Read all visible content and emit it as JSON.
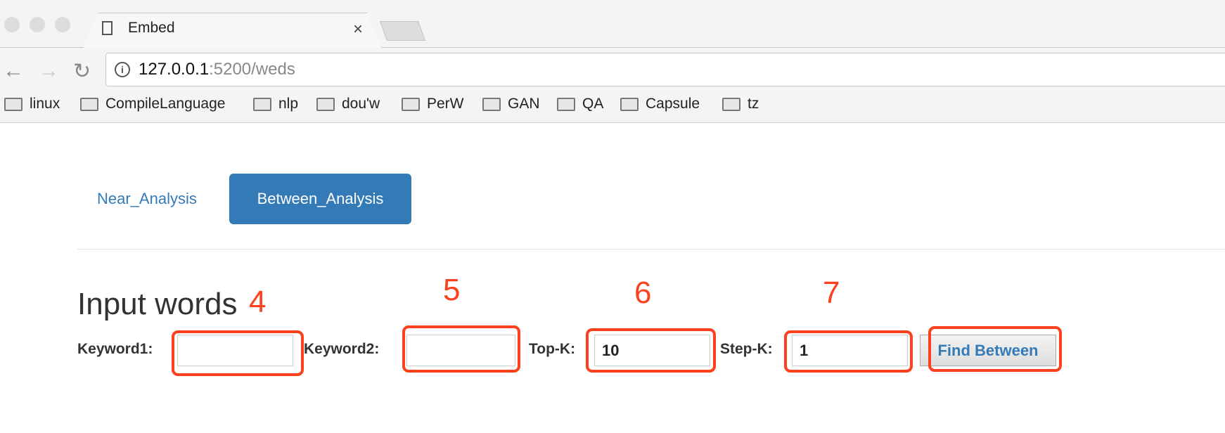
{
  "browser": {
    "tab_title": "Embed",
    "url_host": "127.0.0.1",
    "url_rest": ":5200/weds",
    "bookmarks": [
      "linux",
      "CompileLanguage",
      "nlp",
      "dou'w",
      "PerW",
      "GAN",
      "QA",
      "Capsule",
      "tz"
    ]
  },
  "tabs": [
    {
      "label": "Near_Analysis",
      "active": false
    },
    {
      "label": "Between_Analysis",
      "active": true
    }
  ],
  "section_title": "Input words",
  "form": {
    "keyword1_label": "Keyword1:",
    "keyword1_value": "",
    "keyword2_label": "Keyword2:",
    "keyword2_value": "",
    "topk_label": "Top-K:",
    "topk_value": "10",
    "stepk_label": "Step-K:",
    "stepk_value": "1",
    "submit_label": "Find Between"
  },
  "annotations": [
    "4",
    "5",
    "6",
    "7"
  ],
  "colors": {
    "accent": "#337ab7",
    "annotation": "#fb411e"
  }
}
